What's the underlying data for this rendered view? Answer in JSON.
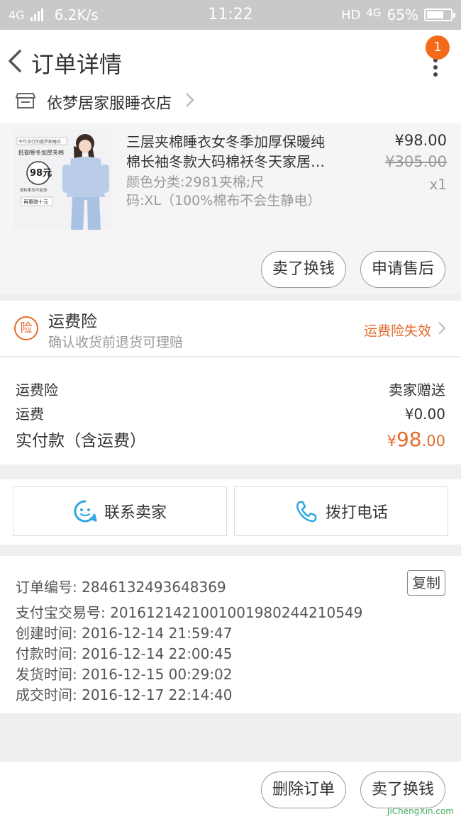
{
  "status_bar": {
    "network": "4G",
    "speed": "6.2K/s",
    "time": "11:22",
    "hd": "HD",
    "net2": "4G",
    "battery": "65%",
    "battery_level": 0.65
  },
  "nav": {
    "title": "订单详情",
    "badge": "1"
  },
  "store": {
    "name": "依梦居家服睡衣店"
  },
  "product": {
    "title_line1": "三层夹棉睡衣女冬季加厚保暖纯",
    "title_line2": "棉长袖冬款大码棉袄冬天家居…",
    "spec_line1": "颜色分类:2981夹棉;尺",
    "spec_line2": "码:XL（100%棉布不会生静电）",
    "price": "¥98.00",
    "original_price": "¥305.00",
    "quantity": "x1",
    "thumb_text": {
      "top": "今年流行的俄罗斯睡衣",
      "mid": "抵御寒冬加厚夹棉",
      "price": "98元",
      "note": "面料柔软不起球",
      "bottom": "再惠赠十元"
    }
  },
  "item_actions": {
    "sell_exchange": "卖了换钱",
    "after_sale": "申请售后"
  },
  "insurance": {
    "icon_text": "险",
    "title": "运费险",
    "subtitle": "确认收货前退货可理赔",
    "status": "运费险失效"
  },
  "fees": {
    "insurance_label": "运费险",
    "insurance_value": "卖家赠送",
    "shipping_label": "运费",
    "shipping_value": "¥0.00",
    "total_label": "实付款（含运费）",
    "total_symbol": "¥",
    "total_int": "98",
    "total_dec": ".00"
  },
  "contact": {
    "seller": "联系卖家",
    "call": "拨打电话"
  },
  "order_info": {
    "copy": "复制",
    "lines": [
      "订单编号: 2846132493648369",
      "支付宝交易号: 2016121421001001980244210549",
      "创建时间: 2016-12-14 21:59:47",
      "付款时间: 2016-12-14 22:00:45",
      "发货时间: 2016-12-15 00:29:02",
      "成交时间: 2016-12-17 22:14:40"
    ]
  },
  "bottom_actions": {
    "delete": "删除订单",
    "sell_exchange": "卖了换钱"
  },
  "watermark": {
    "text": "JiChengXin.com"
  },
  "colors": {
    "accent": "#e36b2c",
    "badge": "#f36a1a",
    "contact_icon": "#2ea7e0"
  }
}
